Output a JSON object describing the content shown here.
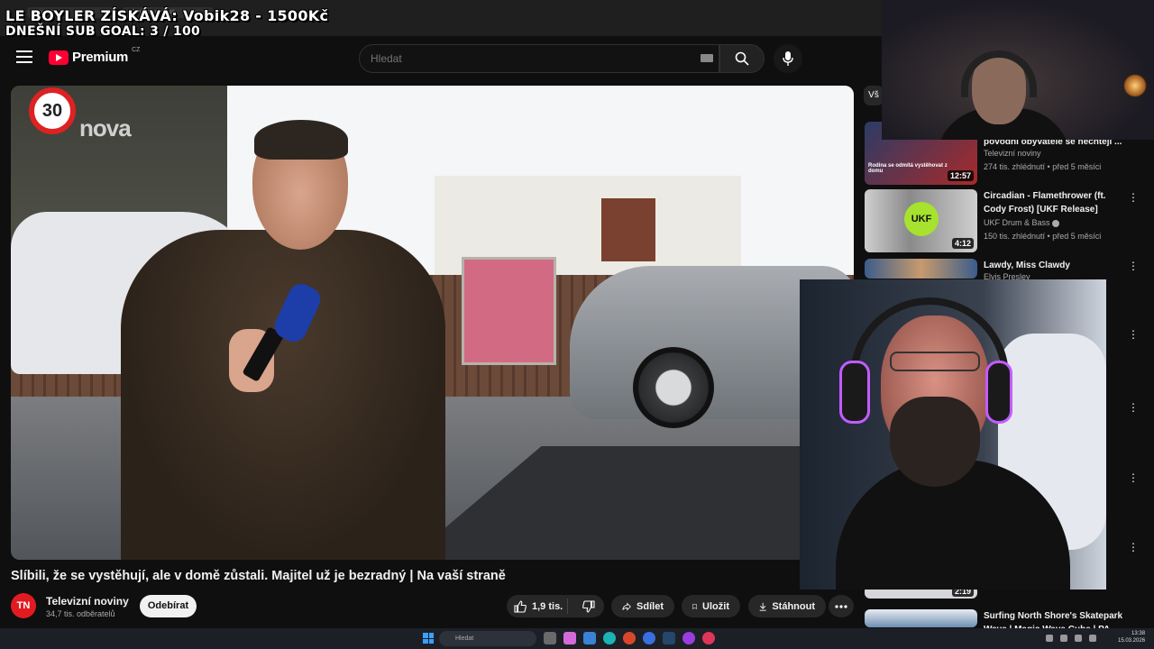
{
  "overlay": {
    "line1": "LE BOYLER ZÍSKÁVÁ: Vobik28 - 1500Kč",
    "line2": "DNEŠNÍ SUB GOAL: 3 / 100"
  },
  "browser": {
    "tabs": [
      "YouTube",
      "Slíbili, že se vystě"
    ]
  },
  "header": {
    "logo_text": "Premium",
    "logo_region": "CZ",
    "search_placeholder": "Hledat"
  },
  "video": {
    "watermark": "nova",
    "speed_sign": "30",
    "title": "Slíbili, že se vystěhují, ale v domě zůstali. Majitel už je bezradný | Na vaší straně"
  },
  "channel": {
    "avatar_initials": "TN",
    "name": "Televizní noviny",
    "subscribers": "34,7 tis. odběratelů",
    "subscribe_label": "Odebírat"
  },
  "actions": {
    "likes": "1,9 tis.",
    "share": "Sdílet",
    "save": "Uložit",
    "download": "Stáhnout"
  },
  "sidebar": {
    "chip": "Vš",
    "items": [
      {
        "title": "povodní obyvatele se nechtějí ...",
        "channel": "Televizní noviny",
        "meta": "274 tis. zhlédnutí • před 5 měsíci",
        "duration": "12:57",
        "thumb_text": "Rodina se odmítá vystěhovat z domu"
      },
      {
        "title": "Circadian - Flamethrower (ft. Cody Frost) [UKF Release]",
        "channel": "UKF Drum & Bass",
        "meta": "150 tis. zhlédnutí • před 5 měsíci",
        "duration": "4:12",
        "thumb_text": "UKF"
      },
      {
        "title": "Lawdy, Miss Clawdy",
        "channel": "Elvis Presley",
        "meta": "",
        "duration": "",
        "thumb_text": ""
      },
      {
        "title": "Surfing North Shore's Skatepark Wave | Magic Wave Cube | PA",
        "channel": "",
        "meta": "",
        "duration": "2:19",
        "thumb_text": ""
      }
    ]
  },
  "taskbar": {
    "search_placeholder": "Hledat",
    "time": "13:38",
    "date": "15.03.2026"
  },
  "colors": {
    "brand_red": "#ff0033",
    "background": "#0f0f0f",
    "pill": "#272727",
    "headset_glow": "#c25cff"
  }
}
